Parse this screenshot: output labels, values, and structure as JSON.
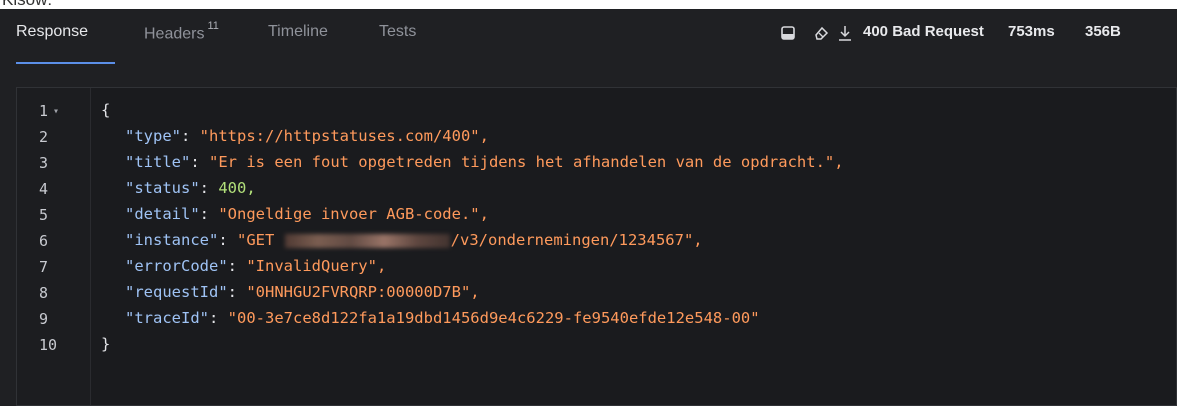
{
  "top_cropped_text": "Klsow:",
  "tabs": [
    {
      "label": "Response",
      "active": true
    },
    {
      "label": "Headers",
      "badge": "11",
      "active": false
    },
    {
      "label": "Timeline",
      "active": false
    },
    {
      "label": "Tests",
      "active": false
    }
  ],
  "status": {
    "text": "400 Bad Request",
    "time": "753ms",
    "size": "356B"
  },
  "icons": [
    "panel-icon",
    "eraser-icon",
    "download-icon"
  ],
  "colors": {
    "background": "#1f2023",
    "editor_bg": "#1a1b1e",
    "accent": "#5b8fe8",
    "key": "#9fc3f5",
    "string": "#ff9a5c",
    "number": "#b2e07a"
  },
  "editor": {
    "lines": [
      {
        "n": "1",
        "fold": "▾"
      },
      {
        "n": "2"
      },
      {
        "n": "3"
      },
      {
        "n": "4"
      },
      {
        "n": "5"
      },
      {
        "n": "6"
      },
      {
        "n": "7"
      },
      {
        "n": "8"
      },
      {
        "n": "9"
      },
      {
        "n": "10"
      }
    ],
    "open_brace": "{",
    "close_brace": "}",
    "fields": [
      {
        "key": "\"type\"",
        "value": "\"https://httpstatuses.com/400\","
      },
      {
        "key": "\"title\"",
        "value": "\"Er is een fout opgetreden tijdens het afhandelen van de opdracht.\","
      },
      {
        "key": "\"status\"",
        "value": "400,"
      },
      {
        "key": "\"detail\"",
        "value": "\"Ongeldige invoer AGB-code.\","
      },
      {
        "key": "\"instance\"",
        "value_prefix": "\"GET ",
        "value_suffix": "/v3/ondernemingen/1234567\","
      },
      {
        "key": "\"errorCode\"",
        "value": "\"InvalidQuery\","
      },
      {
        "key": "\"requestId\"",
        "value": "\"0HNHGU2FVRQRP:00000D7B\","
      },
      {
        "key": "\"traceId\"",
        "value": "\"00-3e7ce8d122fa1a19dbd1456d9e4c6229-fe9540efde12e548-00\""
      }
    ]
  }
}
